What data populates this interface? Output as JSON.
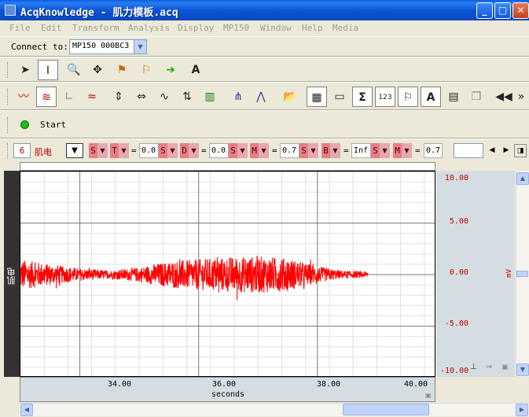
{
  "window": {
    "title": "AcqKnowledge - 肌力模板.acq",
    "minimize_glyph": "_",
    "maximize_glyph": "□",
    "close_glyph": "✕"
  },
  "menu": [
    "File",
    "Edit",
    "Transform",
    "Analysis",
    "Display",
    "MP150",
    "Window",
    "Help",
    "Media"
  ],
  "connect": {
    "label": "Connect to:",
    "value": "MP150 000BC3"
  },
  "toolbar1_icons": [
    "arrow-pointer-icon",
    "i-beam-cursor-icon",
    "zoom-magnifier-icon",
    "move-cross-icon",
    "flag-marker-icon",
    "flag-dropdown-icon",
    "green-arrow-icon",
    "annotation-a-icon"
  ],
  "toolbar2_icons": [
    "wave-overlap-icon",
    "wave-stack-icon",
    "xy-plot-icon",
    "wave-multi-icon",
    "autoscale-vertical-icon",
    "autoscale-horizontal-icon",
    "autoscale-waveform-icon",
    "fit-icon",
    "bar-chart-icon",
    "trigger-up-icon",
    "trigger-peak-icon",
    "open-folder-icon",
    "grid-icon",
    "ruler-icon",
    "sigma-icon",
    "value-123-icon",
    "flag-icon",
    "text-a-icon",
    "journal-icon",
    "copy-icon",
    "rewind-icon",
    "more-chevron-icon"
  ],
  "start": {
    "label": "Start"
  },
  "channel": {
    "number": "6",
    "name": "肌电",
    "measurements": [
      {
        "letter": "S",
        "eq": "",
        "value": ""
      },
      {
        "letter": "T",
        "eq": "=",
        "value": "0.0"
      },
      {
        "letter": "S",
        "eq": "",
        "value": ""
      },
      {
        "letter": "D",
        "eq": "=",
        "value": "0.0"
      },
      {
        "letter": "S",
        "eq": "",
        "value": ""
      },
      {
        "letter": "M",
        "eq": "=",
        "value": "0.7"
      },
      {
        "letter": "S",
        "eq": "",
        "value": ""
      },
      {
        "letter": "B",
        "eq": "=",
        "value": "Inf"
      },
      {
        "letter": "S",
        "eq": "",
        "value": ""
      },
      {
        "letter": "M",
        "eq": "=",
        "value": "0.7"
      }
    ]
  },
  "chart_data": {
    "type": "line",
    "series": [
      {
        "color": "#ff0000",
        "x_range": [
          33.0,
          38.85
        ],
        "amplitude_profile": [
          {
            "x": 33.0,
            "amp": 1.5
          },
          {
            "x": 33.5,
            "amp": 1.0
          },
          {
            "x": 34.0,
            "amp": 0.6
          },
          {
            "x": 34.5,
            "amp": 0.4
          },
          {
            "x": 35.0,
            "amp": 0.7
          },
          {
            "x": 35.5,
            "amp": 1.3
          },
          {
            "x": 36.0,
            "amp": 1.5
          },
          {
            "x": 36.5,
            "amp": 1.7
          },
          {
            "x": 37.0,
            "amp": 1.8
          },
          {
            "x": 37.5,
            "amp": 1.6
          },
          {
            "x": 38.0,
            "amp": 0.8
          },
          {
            "x": 38.4,
            "amp": 0.4
          },
          {
            "x": 38.85,
            "amp": 0.3
          }
        ]
      }
    ],
    "xlim": [
      33.0,
      40.0
    ],
    "ylim": [
      -10.0,
      10.0
    ],
    "x_ticks": [
      "34.00",
      "36.00",
      "38.00",
      "40.00"
    ],
    "y_ticks": [
      "10.00",
      "5.00",
      "0.00",
      "-5.00",
      "-10.00"
    ],
    "y_tick_values": [
      10,
      5,
      0,
      -5,
      -10
    ],
    "x_tick_values": [
      34,
      36,
      38,
      40
    ],
    "xlabel": "seconds",
    "ylabel": "mV",
    "side_label": "肌电",
    "grid": true
  }
}
